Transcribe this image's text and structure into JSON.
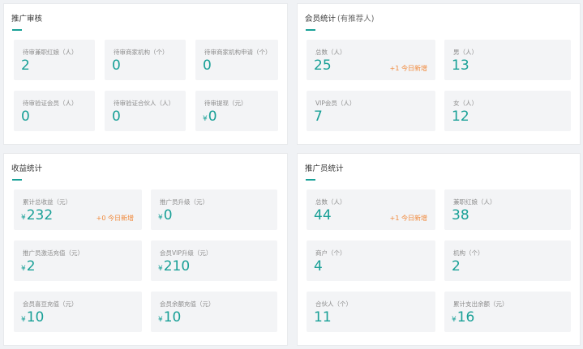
{
  "colors": {
    "accent": "#19a097",
    "delta": "#f0883a",
    "label": "#8c8c8c",
    "card_bg": "#f3f4f6"
  },
  "promo_review": {
    "title": "推广审核",
    "cards": [
      {
        "label": "待审兼职红娘（人）",
        "value": "2"
      },
      {
        "label": "待审商家机构（个）",
        "value": "0"
      },
      {
        "label": "待审商家机构申请（个）",
        "value": "0"
      },
      {
        "label": "待审验证会员（人）",
        "value": "0"
      },
      {
        "label": "待审验证合伙人（人）",
        "value": "0"
      },
      {
        "label": "待审提现（元）",
        "currency": "¥",
        "value": "0"
      }
    ]
  },
  "member_stats": {
    "title": "会员统计",
    "subtitle": "(有推荐人)",
    "cards": [
      {
        "label": "总数（人）",
        "value": "25",
        "delta": "+1 今日新增"
      },
      {
        "label": "男（人）",
        "value": "13"
      },
      {
        "label": "VIP会员（人）",
        "value": "7"
      },
      {
        "label": "女（人）",
        "value": "12"
      }
    ]
  },
  "revenue_stats": {
    "title": "收益统计",
    "cards": [
      {
        "label": "累计总收益（元）",
        "currency": "¥",
        "value": "232",
        "delta": "+0 今日新增"
      },
      {
        "label": "推广员升级（元）",
        "currency": "¥",
        "value": "0"
      },
      {
        "label": "推广员激活充值（元）",
        "currency": "¥",
        "value": "2"
      },
      {
        "label": "会员VIP升级（元）",
        "currency": "¥",
        "value": "210"
      },
      {
        "label": "会员喜豆充值（元）",
        "currency": "¥",
        "value": "10"
      },
      {
        "label": "会员余额充值（元）",
        "currency": "¥",
        "value": "10"
      }
    ]
  },
  "promoter_stats": {
    "title": "推广员统计",
    "cards": [
      {
        "label": "总数（人）",
        "value": "44",
        "delta": "+1 今日新增"
      },
      {
        "label": "兼职红娘（人）",
        "value": "38"
      },
      {
        "label": "商户（个）",
        "value": "4"
      },
      {
        "label": "机构（个）",
        "value": "2"
      },
      {
        "label": "合伙人（个）",
        "value": "11"
      },
      {
        "label": "累计支出余额（元）",
        "currency": "¥",
        "value": "16"
      }
    ]
  }
}
